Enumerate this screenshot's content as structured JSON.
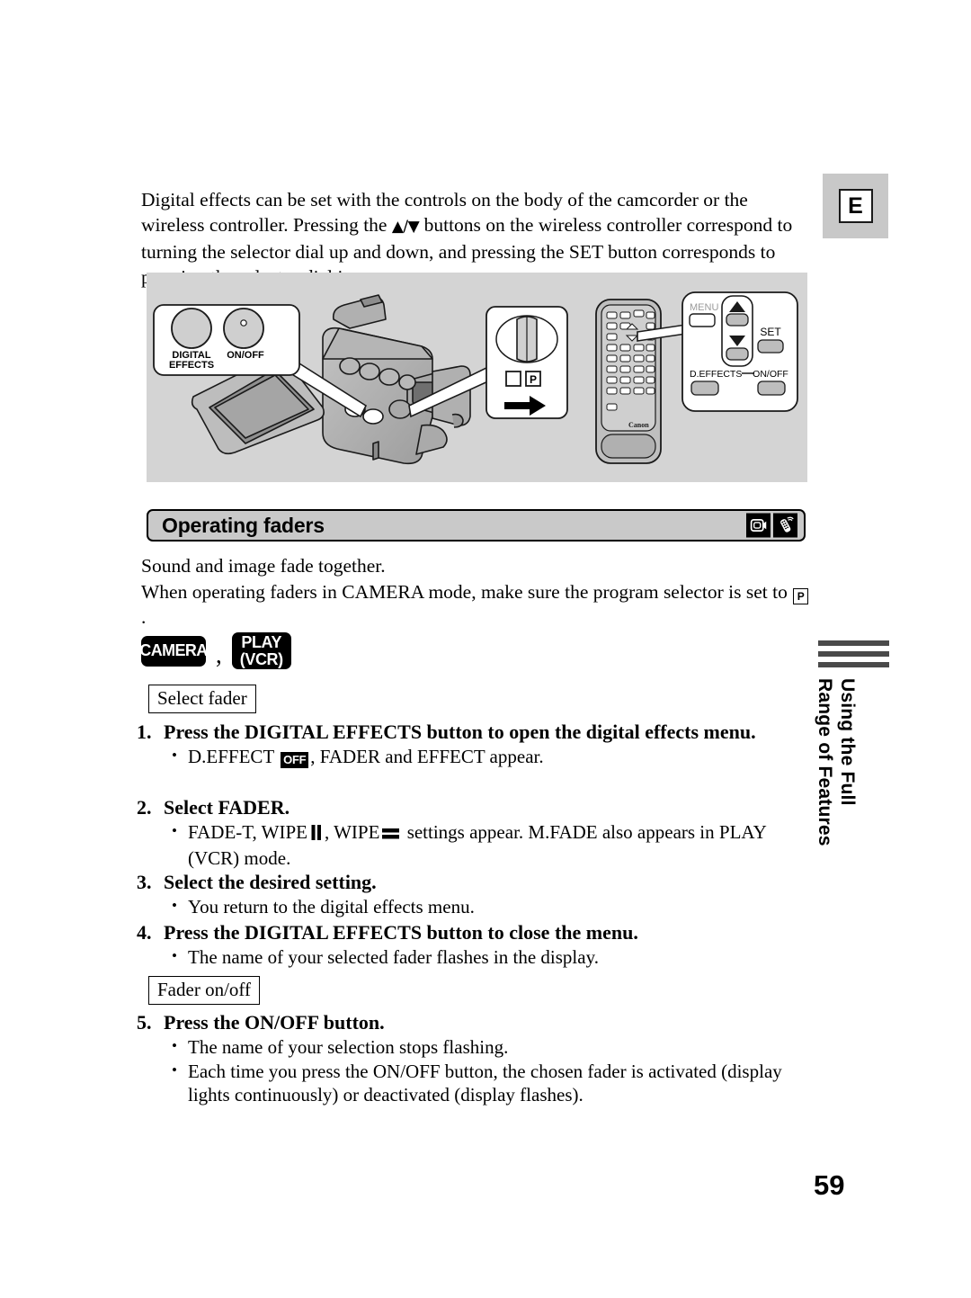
{
  "page": {
    "number": "59",
    "language_badge": "E"
  },
  "intro": {
    "part1": "Digital effects can be set with the controls on the body of the camcorder or the wireless controller. Pressing the ",
    "updown_glyph": "▲/▼",
    "part2": " buttons on the wireless controller correspond to turning the selector dial up and down, and pressing the SET button corresponds to pressing the selector dial in."
  },
  "illustration": {
    "camcorder_callout": {
      "label_left": "DIGITAL EFFECTS",
      "label_left_line1": "DIGITAL",
      "label_left_line2": "EFFECTS",
      "label_right": "ON/OFF"
    },
    "selector_callout": {
      "p_label": "P"
    },
    "remote_callout": {
      "menu": "MENU",
      "set": "SET",
      "deffects": "D.EFFECTS",
      "onoff": "ON/OFF"
    },
    "remote_brand": "Canon"
  },
  "section": {
    "title": "Operating faders",
    "icons": [
      "camcorder-icon",
      "wireless-controller-icon"
    ]
  },
  "body": {
    "line1": "Sound and image fade together.",
    "line2_a": "When operating faders in CAMERA mode, make sure the program selector is set to ",
    "line2_p": "P",
    "line2_b": "."
  },
  "modes": {
    "camera": "CAMERA",
    "separator": ",",
    "play_line1": "PLAY",
    "play_line2": "(VCR)"
  },
  "captions": {
    "select_fader": "Select fader",
    "fader_onoff": "Fader on/off"
  },
  "steps": [
    {
      "num": "1.",
      "title": "Press the DIGITAL EFFECTS button to open the digital effects menu.",
      "bullets_prefix": "D.EFFECT ",
      "bullet_off_badge": "OFF",
      "bullets_suffix": ", FADER and EFFECT appear."
    },
    {
      "num": "2.",
      "title": "Select FADER.",
      "bullet_a": "FADE-T, WIPE",
      "bullet_b": ", WIPE",
      "bullet_c": " settings appear. M.FADE also appears in PLAY (VCR) mode."
    },
    {
      "num": "3.",
      "title": "Select the desired setting.",
      "bullet": "You return to the digital effects menu."
    },
    {
      "num": "4.",
      "title": "Press the DIGITAL EFFECTS button to close the menu.",
      "bullet": "The name of your selected fader flashes in the display."
    },
    {
      "num": "5.",
      "title": "Press the ON/OFF button.",
      "bullet1": "The name of your selection stops flashing.",
      "bullet2": "Each time you press the ON/OFF button, the chosen fader is activated (display lights continuously) or deactivated (display flashes)."
    }
  ],
  "sidebar": {
    "text": "Using the Full\nRange of Features"
  },
  "colors": {
    "illustration_bg": "#d4d4d4",
    "header_bg": "#c9c9c9",
    "badge_bg": "#c8c8c8",
    "sidebar_bar": "#4a4a4a"
  }
}
